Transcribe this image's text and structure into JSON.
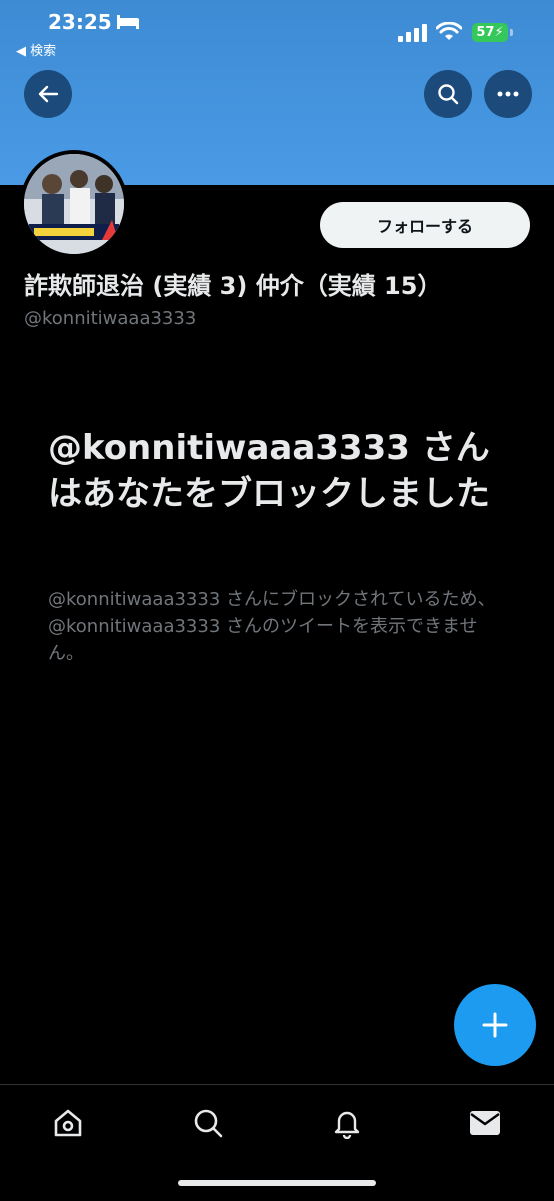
{
  "status_bar": {
    "time": "23:25",
    "back_app_label": "◀ 検索",
    "battery": "57"
  },
  "header": {
    "banner_color": "#4a9ae6",
    "back_icon": "arrow-left-icon",
    "search_icon": "search-icon",
    "more_icon": "more-icon"
  },
  "profile": {
    "follow_label": "フォローする",
    "display_name": "詐欺師退治 (実績 3) 仲介（実績 15）",
    "handle": "@konnitiwaaa3333"
  },
  "blocked": {
    "title": "@konnitiwaaa3333 さんはあなたをブロックしました",
    "description": "@konnitiwaaa3333 さんにブロックされているため、@konnitiwaaa3333 さんのツイートを表示できません。"
  },
  "fab": {
    "icon": "plus-icon",
    "color": "#1d9bf0"
  },
  "bottom_nav": {
    "items": [
      {
        "icon": "home-icon"
      },
      {
        "icon": "search-icon"
      },
      {
        "icon": "bell-icon"
      },
      {
        "icon": "mail-icon"
      }
    ]
  }
}
